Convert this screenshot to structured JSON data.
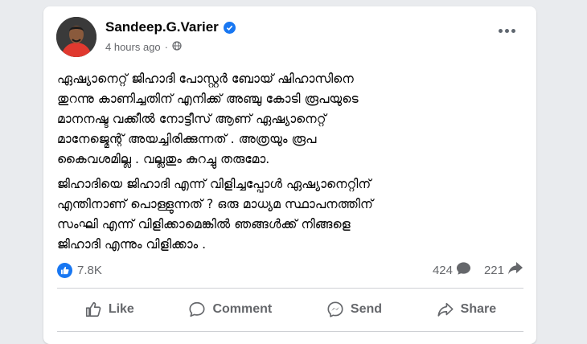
{
  "post": {
    "author": "Sandeep.G.Varier",
    "timestamp": "4 hours ago",
    "separator": "·",
    "paragraphs": [
      "ഏഷ്യാനെറ്റ് ജിഹാദി പോസ്റ്റർ ബോയ് ഷിഹാസിനെ\nതുറന്നു കാണിച്ചതിന് എനിക്ക് അഞ്ചു കോടി രൂപയുടെ\nമാനനഷ്ട വക്കീൽ നോട്ടീസ് ആണ് ഏഷ്യാനെറ്റ്\nമാനേജ്മെന്റ് അയച്ചിരിക്കുന്നത് . അത്രയും രൂപ\nകൈവശമില്ല . വല്ലതും കുറച്ചു തരുമോ.",
      "ജിഹാദിയെ ജിഹാദി എന്ന് വിളിച്ചപ്പോൾ ഏഷ്യാനെറ്റിന്\nഎന്തിനാണ് പൊള്ളുന്നത് ? ഒരു മാധ്യമ സ്ഥാപനത്തിന്\nസംഘി എന്ന് വിളിക്കാമെങ്കിൽ ഞങ്ങൾക്ക് നിങ്ങളെ\nജിഹാദി എന്നും വിളിക്കാം ."
    ]
  },
  "reactions": {
    "likes": "7.8K",
    "comments": "424",
    "shares": "221"
  },
  "actions": {
    "like": "Like",
    "comment": "Comment",
    "send": "Send",
    "share": "Share"
  },
  "colors": {
    "brand_blue": "#1877f2",
    "muted_text": "#65676b",
    "avatar_shirt": "#e0392f"
  },
  "icons": {
    "verified": "verified-badge-icon",
    "privacy": "globe-icon",
    "more": "more-options-icon",
    "like_reaction": "thumbs-up-icon",
    "comment_count": "comment-bubble-icon",
    "share_count": "share-arrow-icon"
  }
}
